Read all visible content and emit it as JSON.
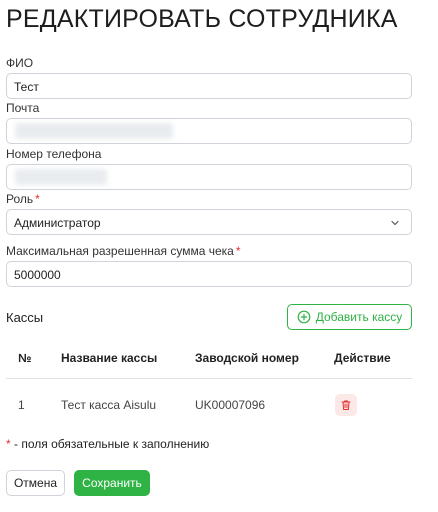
{
  "page": {
    "title": "РЕДАКТИРОВАТЬ СОТРУДНИКА"
  },
  "form": {
    "fio": {
      "label": "ФИО",
      "value": "Тест"
    },
    "email": {
      "label": "Почта"
    },
    "phone": {
      "label": "Номер телефона"
    },
    "role": {
      "label": "Роль",
      "required_mark": "*",
      "value": "Администратор"
    },
    "max_sum": {
      "label": "Максимальная разрешенная сумма чека",
      "required_mark": "*",
      "value": "5000000"
    }
  },
  "cashboxes": {
    "section_title": "Кассы",
    "add_button": "Добавить кассу",
    "columns": [
      "№",
      "Название кассы",
      "Заводской номер",
      "Действие"
    ],
    "rows": [
      {
        "num": "1",
        "name": "Тест касса Aisulu",
        "serial": "UK00007096"
      }
    ]
  },
  "note": {
    "mark": "*",
    "text": " - поля обязательные к заполнению"
  },
  "buttons": {
    "cancel": "Отмена",
    "save": "Сохранить"
  },
  "colors": {
    "accent": "#2fb344",
    "danger": "#e03131",
    "danger_bg": "#fde8e8",
    "border": "#ced4da"
  },
  "icons": {
    "add": "plus-circle-icon",
    "delete": "trash-icon",
    "select": "chevron-down-icon"
  }
}
